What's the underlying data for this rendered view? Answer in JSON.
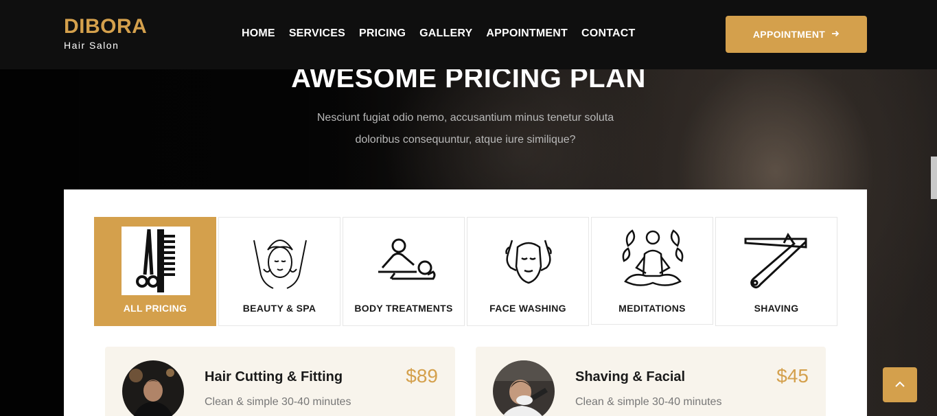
{
  "header": {
    "logo_title": "DIBORA",
    "logo_subtitle": "Hair Salon",
    "nav": [
      "HOME",
      "SERVICES",
      "PRICING",
      "GALLERY",
      "APPOINTMENT",
      "CONTACT"
    ],
    "cta_label": "APPOINTMENT",
    "cta_icon": "arrow-right-icon"
  },
  "hero": {
    "title": "AWESOME PRICING PLAN",
    "subtitle_line1": "Nesciunt fugiat odio nemo, accusantium minus tenetur soluta",
    "subtitle_line2": "doloribus consequuntur, atque iure similique?"
  },
  "tabs": [
    {
      "label": "ALL PRICING",
      "icon": "scissors-comb-icon",
      "active": true
    },
    {
      "label": "BEAUTY & SPA",
      "icon": "spa-face-icon",
      "active": false
    },
    {
      "label": "BODY TREATMENTS",
      "icon": "massage-icon",
      "active": false
    },
    {
      "label": "FACE WASHING",
      "icon": "face-wash-icon",
      "active": false
    },
    {
      "label": "MEDITATIONS",
      "icon": "meditation-icon",
      "active": false
    },
    {
      "label": "SHAVING",
      "icon": "razor-icon",
      "active": false
    }
  ],
  "cards": [
    {
      "title": "Hair Cutting & Fitting",
      "description": "Clean & simple 30-40 minutes",
      "price": "$89"
    },
    {
      "title": "Shaving & Facial",
      "description": "Clean & simple 30-40 minutes",
      "price": "$45"
    }
  ],
  "colors": {
    "accent": "#d4a04c",
    "header_bg": "#0f0f0f",
    "card_bg": "#f8f4ec"
  }
}
